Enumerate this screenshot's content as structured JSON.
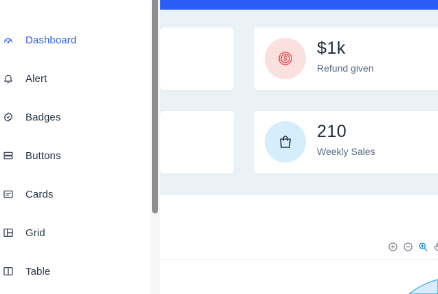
{
  "sidebar": {
    "items": [
      {
        "label": "Dashboard",
        "icon": "dashboard-gauge-icon",
        "active": true
      },
      {
        "label": "Alert",
        "icon": "bell-icon",
        "active": false
      },
      {
        "label": "Badges",
        "icon": "badge-check-icon",
        "active": false
      },
      {
        "label": "Buttons",
        "icon": "buttons-icon",
        "active": false
      },
      {
        "label": "Cards",
        "icon": "card-icon",
        "active": false
      },
      {
        "label": "Grid",
        "icon": "grid-layout-icon",
        "active": false
      },
      {
        "label": "Table",
        "icon": "table-columns-icon",
        "active": false
      }
    ]
  },
  "stats": [
    {
      "value": "$1k",
      "label": "Refund given",
      "icon": "coin-icon",
      "icon_bg": "#fbe0e0",
      "icon_color": "#e25555"
    },
    {
      "value": "210",
      "label": "Weekly Sales",
      "icon": "shopping-bag-icon",
      "icon_bg": "#d6edfb",
      "icon_color": "#2a3547"
    }
  ],
  "chart_toolbar": [
    "zoom-in-icon",
    "zoom-out-icon",
    "zoom-selection-icon",
    "pan-hand-icon"
  ],
  "colors": {
    "accent": "#3561e8",
    "topbar": "#2a5cf6",
    "stats_bg": "#eaf2f5"
  }
}
